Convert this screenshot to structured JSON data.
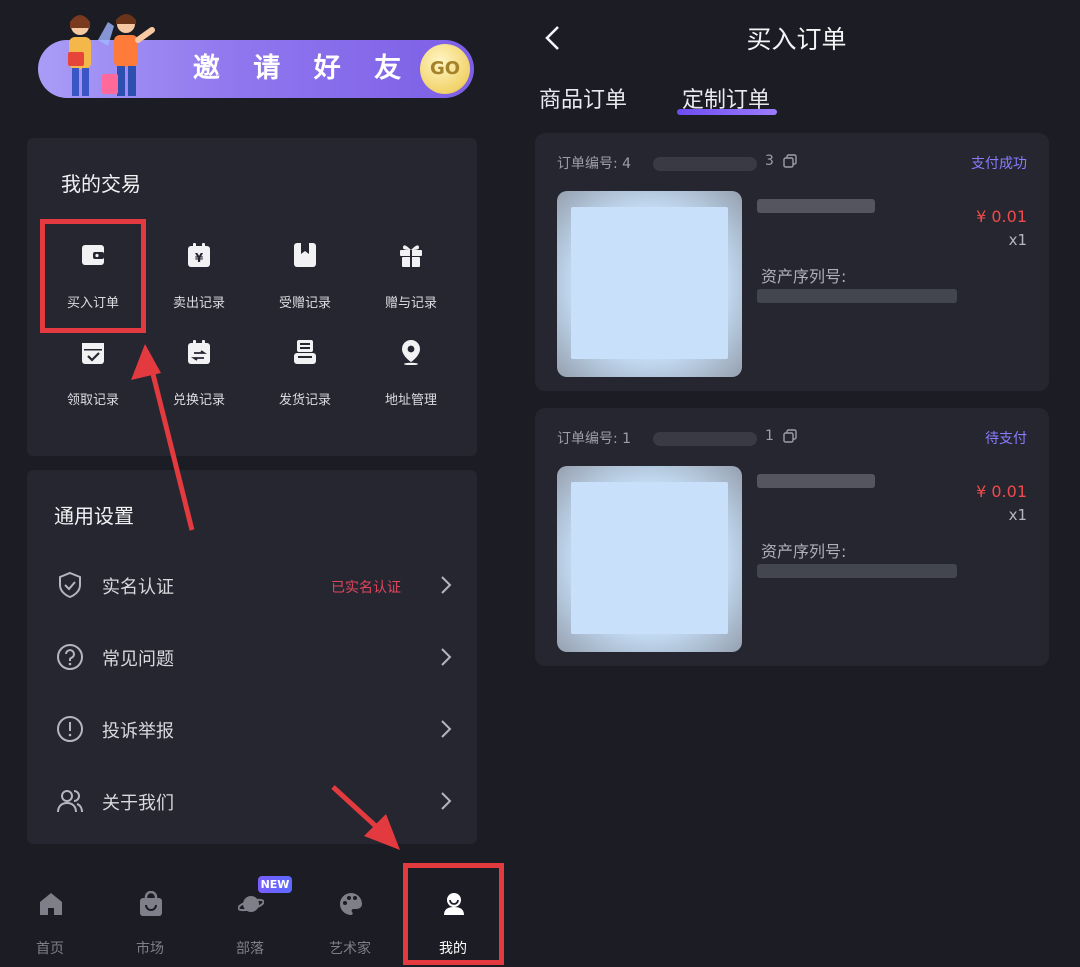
{
  "left": {
    "banner": {
      "text": "邀 请 好 友",
      "go": "GO"
    },
    "trade": {
      "title": "我的交易",
      "items": [
        {
          "label": "买入订单",
          "icon": "wallet-icon"
        },
        {
          "label": "卖出记录",
          "icon": "yen-calendar-icon"
        },
        {
          "label": "受赠记录",
          "icon": "bookmark-box-icon"
        },
        {
          "label": "赠与记录",
          "icon": "gift-icon"
        },
        {
          "label": "领取记录",
          "icon": "calendar-check-icon"
        },
        {
          "label": "兑换记录",
          "icon": "calendar-swap-icon"
        },
        {
          "label": "发货记录",
          "icon": "printer-icon"
        },
        {
          "label": "地址管理",
          "icon": "location-pin-icon"
        }
      ]
    },
    "settings": {
      "title": "通用设置",
      "rows": [
        {
          "label": "实名认证",
          "status": "已实名认证",
          "icon": "shield-check-icon"
        },
        {
          "label": "常见问题",
          "status": "",
          "icon": "question-circle-icon"
        },
        {
          "label": "投诉举报",
          "status": "",
          "icon": "exclamation-circle-icon"
        },
        {
          "label": "关于我们",
          "status": "",
          "icon": "users-icon"
        }
      ]
    },
    "tabbar": {
      "tabs": [
        {
          "label": "首页",
          "icon": "home-icon"
        },
        {
          "label": "市场",
          "icon": "shopping-bag-icon"
        },
        {
          "label": "部落",
          "icon": "planet-icon"
        },
        {
          "label": "艺术家",
          "icon": "palette-icon"
        },
        {
          "label": "我的",
          "icon": "user-icon"
        }
      ],
      "new_badge": "NEW",
      "active": "我的"
    }
  },
  "right": {
    "title": "买入订单",
    "tabs": [
      {
        "label": "商品订单"
      },
      {
        "label": "定制订单"
      }
    ],
    "active_tab": "定制订单",
    "orders": [
      {
        "no_label": "订单编号: 4",
        "no_suffix": "3",
        "status": "支付成功",
        "price": "¥ 0.01",
        "qty": "x1",
        "serial_label": "资产序列号:"
      },
      {
        "no_label": "订单编号: 1",
        "no_suffix": "1",
        "status": "待支付",
        "price": "¥ 0.01",
        "qty": "x1",
        "serial_label": "资产序列号:"
      }
    ]
  },
  "colors": {
    "accent": "#7c5fe6",
    "highlight": "#e23a3f",
    "price": "#f04a4a",
    "status": "#8a7bff",
    "verified": "#e2455d"
  }
}
